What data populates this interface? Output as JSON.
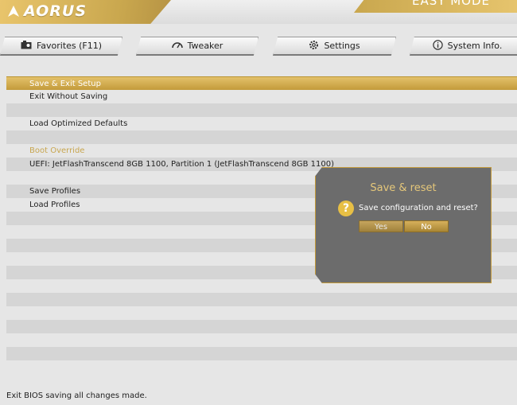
{
  "header": {
    "brand": "AORUS",
    "mode_label": "EASY MODE"
  },
  "tabs": [
    {
      "label": "Favorites (F11)",
      "icon": "star-folder-icon"
    },
    {
      "label": "Tweaker",
      "icon": "speedometer-icon"
    },
    {
      "label": "Settings",
      "icon": "gear-icon"
    },
    {
      "label": "System Info.",
      "icon": "info-icon"
    }
  ],
  "menu": {
    "items": [
      {
        "label": "Save & Exit Setup",
        "selected": true
      },
      {
        "label": "Exit Without Saving"
      },
      {
        "label": ""
      },
      {
        "label": "Load Optimized Defaults"
      },
      {
        "label": ""
      },
      {
        "label": "Boot Override",
        "section_header": true
      },
      {
        "label": "UEFI: JetFlashTranscend 8GB 1100, Partition 1 (JetFlashTranscend 8GB 1100)"
      },
      {
        "label": ""
      },
      {
        "label": "Save Profiles"
      },
      {
        "label": "Load Profiles"
      }
    ]
  },
  "dialog": {
    "title": "Save & reset",
    "message": "Save configuration and reset?",
    "yes_label": "Yes",
    "no_label": "No"
  },
  "footer": {
    "help_text": "Exit BIOS saving all changes made."
  },
  "colors": {
    "accent_gold": "#c9a74e",
    "dialog_bg": "#6c6c6c",
    "question_icon": "#e7bf45"
  }
}
